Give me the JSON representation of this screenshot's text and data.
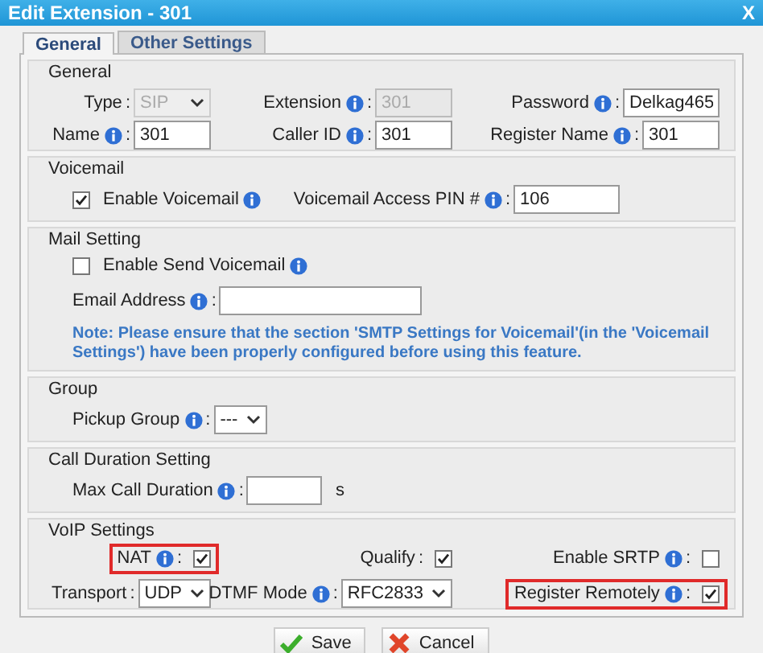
{
  "window": {
    "title": "Edit Extension - 301",
    "close": "X"
  },
  "tabs": [
    {
      "label": "General",
      "selected": true
    },
    {
      "label": "Other Settings",
      "selected": false
    }
  ],
  "sections": [
    {
      "title": "General",
      "rows": [
        [
          {
            "kind": "select",
            "label": "Type",
            "info": false,
            "separator": ":",
            "value": "SIP",
            "disabled": true
          },
          {
            "kind": "text",
            "label": "Extension",
            "info": true,
            "separator": ":",
            "value": "301",
            "disabled": true
          },
          {
            "kind": "text",
            "label": "Password",
            "info": true,
            "separator": ":",
            "value": "Delkag465",
            "disabled": false
          }
        ],
        [
          {
            "kind": "text",
            "label": "Name",
            "info": true,
            "separator": ":",
            "value": "301",
            "disabled": false
          },
          {
            "kind": "text",
            "label": "Caller ID",
            "info": true,
            "separator": ":",
            "value": "301",
            "disabled": false
          },
          {
            "kind": "text",
            "label": "Register Name",
            "info": true,
            "separator": ":",
            "value": "301",
            "disabled": false
          }
        ]
      ]
    },
    {
      "title": "Voicemail",
      "rows": [
        [
          {
            "kind": "option",
            "label": "Enable Voicemail",
            "info": true,
            "checked": true
          },
          {
            "kind": "text",
            "label": "Voicemail Access PIN #",
            "info": true,
            "separator": ":",
            "value": "106",
            "disabled": false
          }
        ]
      ]
    },
    {
      "title": "Mail Setting",
      "rows": [
        [
          {
            "kind": "option",
            "label": "Enable Send Voicemail",
            "info": true,
            "checked": false
          }
        ],
        [
          {
            "kind": "text",
            "label": "Email Address",
            "info": true,
            "separator": ":",
            "disabled": false
          }
        ],
        [
          {
            "kind": "note",
            "text": "Note: Please ensure that the section 'SMTP Settings for Voicemail'(in the 'Voicemail Settings') have been properly configured before using this feature."
          }
        ]
      ]
    },
    {
      "title": "Group",
      "rows": [
        [
          {
            "kind": "select",
            "label": "Pickup Group",
            "info": true,
            "separator": ":",
            "value": "---",
            "disabled": false
          }
        ]
      ]
    },
    {
      "title": "Call Duration Setting",
      "rows": [
        [
          {
            "kind": "text",
            "label": "Max Call Duration",
            "info": true,
            "separator": ":",
            "disabled": false,
            "unit": "s"
          }
        ]
      ]
    },
    {
      "title": "VoIP Settings",
      "rows": [
        [
          {
            "kind": "checkbox",
            "label": "NAT",
            "info": true,
            "separator": ":",
            "checked": true,
            "highlighted": true
          },
          {
            "kind": "checkbox",
            "label": "Qualify",
            "info": false,
            "separator": ":",
            "checked": true,
            "highlighted": false
          },
          {
            "kind": "checkbox",
            "label": "Enable SRTP",
            "info": true,
            "separator": ":",
            "checked": false,
            "highlighted": false
          }
        ],
        [
          {
            "kind": "select",
            "label": "Transport",
            "info": false,
            "separator": ":",
            "value": "UDP",
            "disabled": false,
            "highlighted": false
          },
          {
            "kind": "select",
            "label": "DTMF Mode",
            "info": true,
            "separator": ":",
            "value": "RFC2833",
            "disabled": false,
            "highlighted": false
          },
          {
            "kind": "checkbox",
            "label": "Register Remotely",
            "info": true,
            "separator": ":",
            "checked": true,
            "highlighted": true
          }
        ]
      ]
    }
  ],
  "buttons": [
    {
      "kind": "save",
      "label": "Save"
    },
    {
      "kind": "cancel",
      "label": "Cancel"
    }
  ]
}
